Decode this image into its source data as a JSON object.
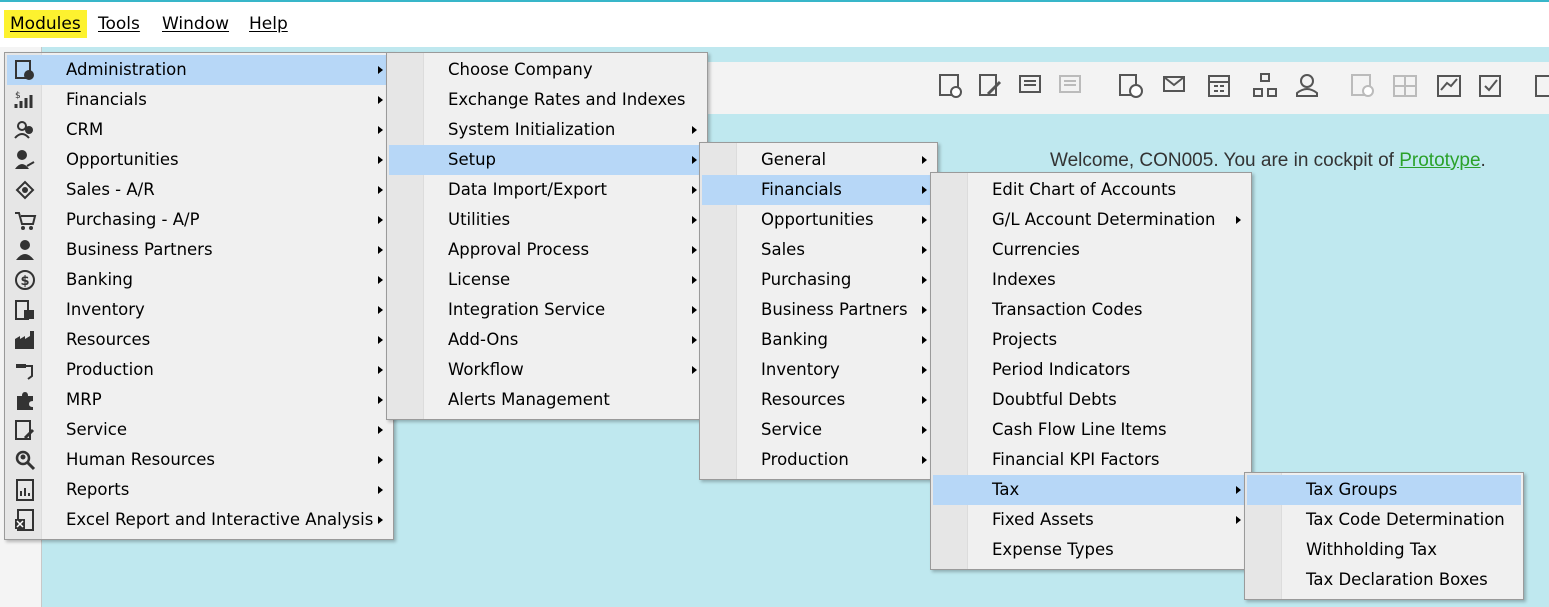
{
  "menubar": {
    "items": [
      {
        "label": "Modules",
        "active": true
      },
      {
        "label": "Tools",
        "active": false
      },
      {
        "label": "Window",
        "active": false
      },
      {
        "label": "Help",
        "active": false
      }
    ]
  },
  "welcome": {
    "prefix": "Welcome, CON005. You are in cockpit of ",
    "company": "Prototype",
    "suffix": "."
  },
  "menus": {
    "modules": [
      {
        "label": "Administration",
        "icon": "administration-icon",
        "submenu": true,
        "highlight": true
      },
      {
        "label": "Financials",
        "icon": "financials-icon",
        "submenu": true
      },
      {
        "label": "CRM",
        "icon": "crm-icon",
        "submenu": true
      },
      {
        "label": "Opportunities",
        "icon": "opportunities-icon",
        "submenu": true
      },
      {
        "label": "Sales - A/R",
        "icon": "sales-icon",
        "submenu": true
      },
      {
        "label": "Purchasing - A/P",
        "icon": "purchasing-cart-icon",
        "submenu": true
      },
      {
        "label": "Business Partners",
        "icon": "business-partner-icon",
        "submenu": true
      },
      {
        "label": "Banking",
        "icon": "banking-dollar-icon",
        "submenu": true
      },
      {
        "label": "Inventory",
        "icon": "inventory-icon",
        "submenu": true
      },
      {
        "label": "Resources",
        "icon": "resources-factory-icon",
        "submenu": true
      },
      {
        "label": "Production",
        "icon": "production-icon",
        "submenu": true
      },
      {
        "label": "MRP",
        "icon": "mrp-puzzle-icon",
        "submenu": true
      },
      {
        "label": "Service",
        "icon": "service-icon",
        "submenu": true
      },
      {
        "label": "Human Resources",
        "icon": "human-resources-icon",
        "submenu": true
      },
      {
        "label": "Reports",
        "icon": "reports-icon",
        "submenu": true
      },
      {
        "label": "Excel Report and Interactive Analysis",
        "icon": "excel-report-icon",
        "submenu": true
      }
    ],
    "administration": [
      {
        "label": "Choose Company",
        "submenu": false
      },
      {
        "label": "Exchange Rates and Indexes",
        "submenu": false
      },
      {
        "label": "System Initialization",
        "submenu": true
      },
      {
        "label": "Setup",
        "submenu": true,
        "highlight": true
      },
      {
        "label": "Data Import/Export",
        "submenu": true
      },
      {
        "label": "Utilities",
        "submenu": true
      },
      {
        "label": "Approval Process",
        "submenu": true
      },
      {
        "label": "License",
        "submenu": true
      },
      {
        "label": "Integration Service",
        "submenu": true
      },
      {
        "label": "Add-Ons",
        "submenu": true
      },
      {
        "label": "Workflow",
        "submenu": true
      },
      {
        "label": "Alerts Management",
        "submenu": false
      }
    ],
    "setup": [
      {
        "label": "General",
        "submenu": true
      },
      {
        "label": "Financials",
        "submenu": true,
        "highlight": true
      },
      {
        "label": "Opportunities",
        "submenu": true
      },
      {
        "label": "Sales",
        "submenu": true
      },
      {
        "label": "Purchasing",
        "submenu": true
      },
      {
        "label": "Business Partners",
        "submenu": true
      },
      {
        "label": "Banking",
        "submenu": true
      },
      {
        "label": "Inventory",
        "submenu": true
      },
      {
        "label": "Resources",
        "submenu": true
      },
      {
        "label": "Service",
        "submenu": true
      },
      {
        "label": "Production",
        "submenu": true
      }
    ],
    "financials": [
      {
        "label": "Edit Chart of Accounts",
        "submenu": false
      },
      {
        "label": "G/L Account Determination",
        "submenu": true
      },
      {
        "label": "Currencies",
        "submenu": false
      },
      {
        "label": "Indexes",
        "submenu": false
      },
      {
        "label": "Transaction Codes",
        "submenu": false
      },
      {
        "label": "Projects",
        "submenu": false
      },
      {
        "label": "Period Indicators",
        "submenu": false
      },
      {
        "label": "Doubtful Debts",
        "submenu": false
      },
      {
        "label": "Cash Flow Line Items",
        "submenu": false
      },
      {
        "label": "Financial KPI Factors",
        "submenu": false
      },
      {
        "label": "Tax",
        "submenu": true,
        "highlight": true
      },
      {
        "label": "Fixed Assets",
        "submenu": true
      },
      {
        "label": "Expense Types",
        "submenu": false
      }
    ],
    "tax": [
      {
        "label": "Tax Groups",
        "submenu": false,
        "highlight": true
      },
      {
        "label": "Tax Code Determination",
        "submenu": false
      },
      {
        "label": "Withholding Tax",
        "submenu": false
      },
      {
        "label": "Tax Declaration Boxes",
        "submenu": false
      }
    ]
  },
  "colors": {
    "workspace": "#bfe8ef",
    "highlight": "#b7d7f7",
    "menubar_active": "#fdf22f",
    "link": "#2aa12a"
  }
}
